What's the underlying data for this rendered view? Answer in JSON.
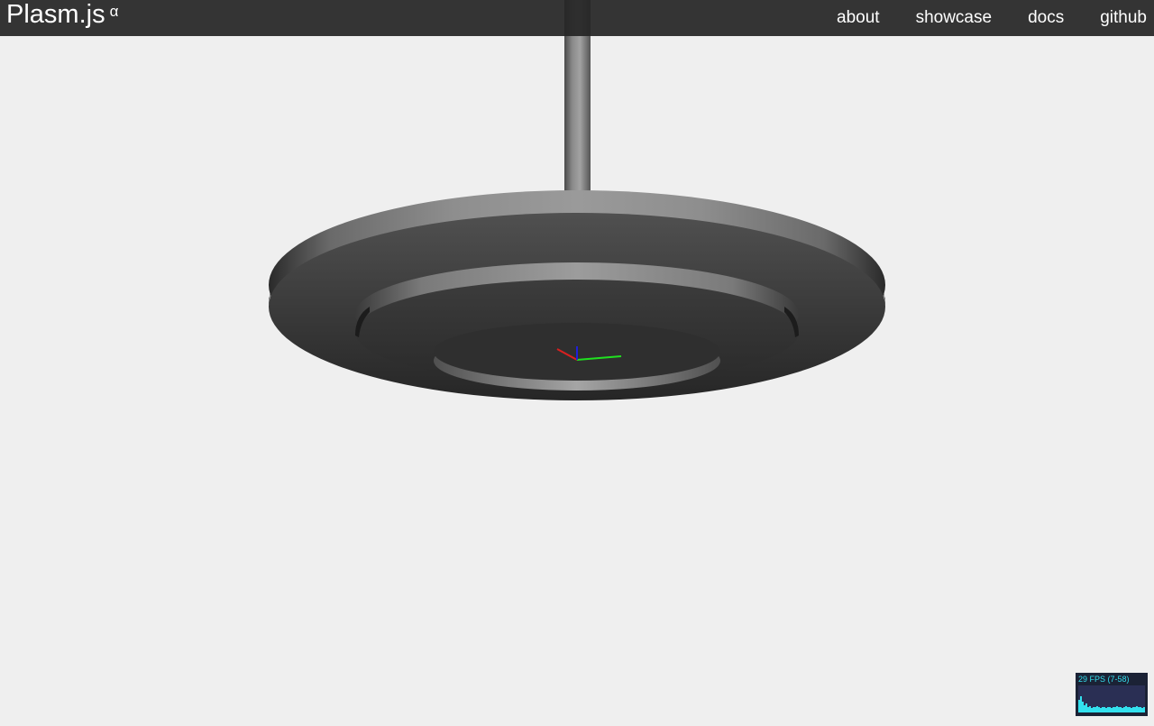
{
  "app": {
    "brand_name": "Plasm.js",
    "brand_suffix": "α"
  },
  "nav": {
    "items": [
      {
        "label": "about"
      },
      {
        "label": "showcase"
      },
      {
        "label": "docs"
      },
      {
        "label": "github"
      }
    ]
  },
  "stats": {
    "fps_text": "29 FPS (7-58)"
  },
  "scene": {
    "background": "#efefef",
    "model_color": "#4a4a4a",
    "axes": {
      "x_color": "#d92020",
      "y_color": "#20e020",
      "z_color": "#2020d9"
    }
  },
  "colors": {
    "topbar": "#262626",
    "stats_bg": "#1b2235",
    "stats_accent": "#33e0ee"
  }
}
